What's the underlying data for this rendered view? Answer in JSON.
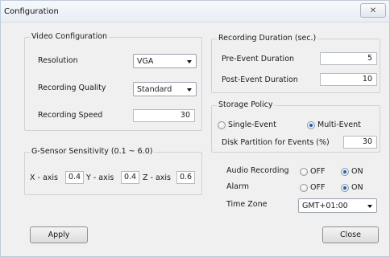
{
  "window": {
    "title": "Configuration",
    "close_glyph": "✕"
  },
  "video": {
    "legend": "Video Configuration",
    "resolution_label": "Resolution",
    "resolution_value": "VGA",
    "quality_label": "Recording Quality",
    "quality_value": "Standard",
    "speed_label": "Recording Speed",
    "speed_value": "30"
  },
  "gsensor": {
    "legend": "G-Sensor Sensitivity (0.1 ~ 6.0)",
    "x_label": "X - axis",
    "x_value": "0.4",
    "y_label": "Y - axis",
    "y_value": "0.4",
    "z_label": "Z - axis",
    "z_value": "0.6"
  },
  "duration": {
    "legend": "Recording Duration (sec.)",
    "pre_label": "Pre-Event Duration",
    "pre_value": "5",
    "post_label": "Post-Event Duration",
    "post_value": "10"
  },
  "storage": {
    "legend": "Storage Policy",
    "single_label": "Single-Event",
    "multi_label": "Multi-Event",
    "selected": "Multi-Event",
    "partition_label": "Disk Partition for Events (%)",
    "partition_value": "30"
  },
  "misc": {
    "audio_label": "Audio Recording",
    "audio_off": "OFF",
    "audio_on": "ON",
    "audio_selected": "ON",
    "alarm_label": "Alarm",
    "alarm_off": "OFF",
    "alarm_on": "ON",
    "alarm_selected": "ON",
    "timezone_label": "Time Zone",
    "timezone_value": "GMT+01:00"
  },
  "buttons": {
    "apply": "Apply",
    "close": "Close"
  }
}
